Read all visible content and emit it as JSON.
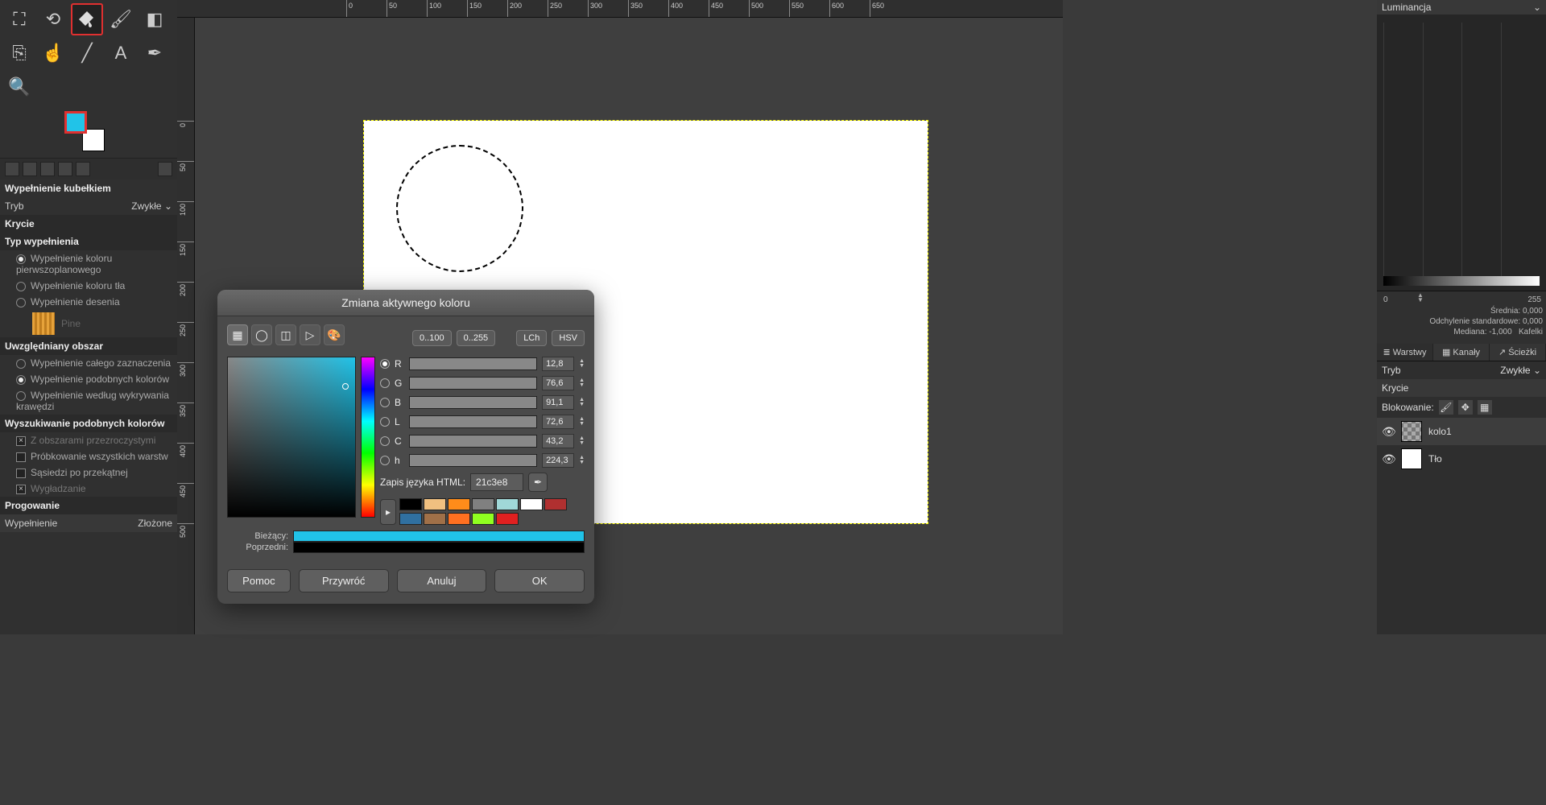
{
  "toolbox": {
    "title": "Wypełnienie kubełkiem",
    "mode_label": "Tryb",
    "mode_value": "Zwykłe",
    "opacity_label": "Krycie",
    "fill_type_label": "Typ wypełnienia",
    "fill_types": {
      "fg": "Wypełnienie koloru pierwszoplanowego",
      "bg": "Wypełnienie koloru tła",
      "pattern": "Wypełnienie desenia"
    },
    "pattern_name": "Pine",
    "area_label": "Uwzględniany obszar",
    "areas": {
      "whole": "Wypełnienie całego zaznaczenia",
      "similar": "Wypełnienie podobnych kolorów",
      "detected": "Wypełnienie według wykrywania krawędzi"
    },
    "find_label": "Wyszukiwanie podobnych kolorów",
    "checks": {
      "transparent": "Z obszarami przezroczystymi",
      "sample": "Próbkowanie wszystkich warstw",
      "diagonal": "Sąsiedzi po przekątnej",
      "antialias": "Wygładzanie"
    },
    "threshold_label": "Progowanie",
    "fill_by_label": "Wypełnienie",
    "fill_by_value": "Złożone"
  },
  "colors": {
    "fg": "#21c3e8",
    "bg": "#ffffff"
  },
  "dialog": {
    "title": "Zmiana aktywnego koloru",
    "range_small": "0..100",
    "range_big": "0..255",
    "lch": "LCh",
    "hsv": "HSV",
    "channels": {
      "R": "12,8",
      "G": "76,6",
      "B": "91,1",
      "L": "72,6",
      "C": "43,2",
      "h": "224,3"
    },
    "html_label": "Zapis języka HTML:",
    "html_value": "21c3e8",
    "current_label": "Bieżący:",
    "previous_label": "Poprzedni:",
    "swatches_a": [
      "#000000",
      "#f0c080",
      "#ff8c1a",
      "#808080",
      "#a0d8d8",
      "#ffffff"
    ],
    "swatches_b": [
      "#b03030",
      "#3070a0",
      "#a07048",
      "#ff7020",
      "#90ff20",
      "#e02020"
    ],
    "buttons": {
      "help": "Pomoc",
      "reset": "Przywróć",
      "cancel": "Anuluj",
      "ok": "OK"
    }
  },
  "right": {
    "dropdown_top": "Luminancja",
    "histo_left": "0",
    "histo_right": "255",
    "stats": {
      "mean_label": "Średnia:",
      "mean": "0,000",
      "stddev_label": "Odchylenie standardowe:",
      "stddev": "0,000",
      "median_label": "Mediana:",
      "median": "-1,000",
      "tiles_label": "Kafelki"
    },
    "tabs": {
      "layers": "Warstwy",
      "channels": "Kanały",
      "paths": "Ścieżki"
    },
    "mode_label": "Tryb",
    "mode_value": "Zwykłe",
    "opacity_label": "Krycie",
    "lock_label": "Blokowanie:",
    "layers": [
      {
        "name": "kolo1",
        "thumb": "checker"
      },
      {
        "name": "Tło",
        "thumb": "white"
      }
    ]
  },
  "ruler": {
    "top": [
      "0",
      "50",
      "100",
      "150",
      "200",
      "250",
      "300",
      "350",
      "400",
      "450",
      "500",
      "550",
      "600",
      "650"
    ],
    "left": [
      "0",
      "50",
      "100",
      "150",
      "200",
      "250",
      "300",
      "350",
      "400",
      "450",
      "500"
    ]
  }
}
